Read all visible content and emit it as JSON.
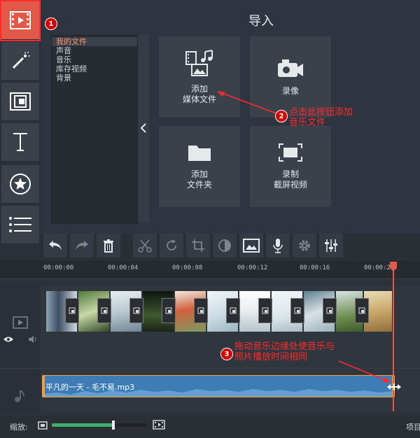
{
  "section_title": "导入",
  "file_list": [
    "我的文件",
    "声音",
    "音乐",
    "库存视频",
    "背景"
  ],
  "tiles": [
    {
      "label": "添加\n媒体文件",
      "icon": "add-media-icon"
    },
    {
      "label": "录像",
      "icon": "camera-icon"
    },
    {
      "label": "添加\n文件夹",
      "icon": "folder-icon"
    },
    {
      "label": "录制\n截屏视频",
      "icon": "screen-capture-icon"
    }
  ],
  "annotations": {
    "badge1": "1",
    "badge2": "2",
    "badge2_text": "点击此按钮添加\n音乐文件",
    "badge3": "3",
    "badge3_text": "拖动音乐边缘处使音乐与\n照片播放时间相同"
  },
  "timeline": {
    "ticks": [
      "00:00:00",
      "00:00:04",
      "00:00:08",
      "00:00:12",
      "00:00:16",
      "00:00:2"
    ],
    "audio_clip": "平凡的一天 - 毛不易.mp3"
  },
  "bottom": {
    "zoom_label": "缩放:",
    "zoom_level": 0.65,
    "right_label": "项目"
  },
  "colors": {
    "accent": "#e2594a",
    "annotation_red": "#ff2a2a",
    "audio_clip": "#3d7cb5",
    "playhead": "#e2594a"
  }
}
